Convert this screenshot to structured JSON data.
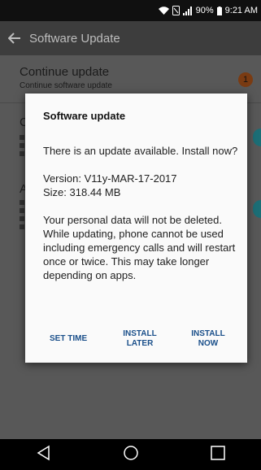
{
  "status_bar": {
    "battery": "90%",
    "time": "9:21 AM"
  },
  "app_bar": {
    "title": "Software Update"
  },
  "settings": {
    "continue_update": {
      "title": "Continue update",
      "subtitle": "Continue software update",
      "badge": "1"
    },
    "partial_row_2_letter": "C",
    "partial_row_3_letter": "A"
  },
  "dialog": {
    "title": "Software update",
    "message": "There is an update available. Install now?",
    "version": "Version: V11y-MAR-17-2017",
    "size": "Size: 318.44 MB",
    "notice": "Your personal data will not be deleted. While updating, phone cannot be used including emergency calls and will restart once or twice. This may take longer depending on apps.",
    "buttons": {
      "set_time": "SET TIME",
      "install_later_line1": "INSTALL",
      "install_later_line2": "LATER",
      "install_now_line1": "INSTALL",
      "install_now_line2": "NOW"
    }
  },
  "colors": {
    "accent": "#1a4f8a",
    "badge": "#7a3b12",
    "teal": "#1c6e76"
  }
}
